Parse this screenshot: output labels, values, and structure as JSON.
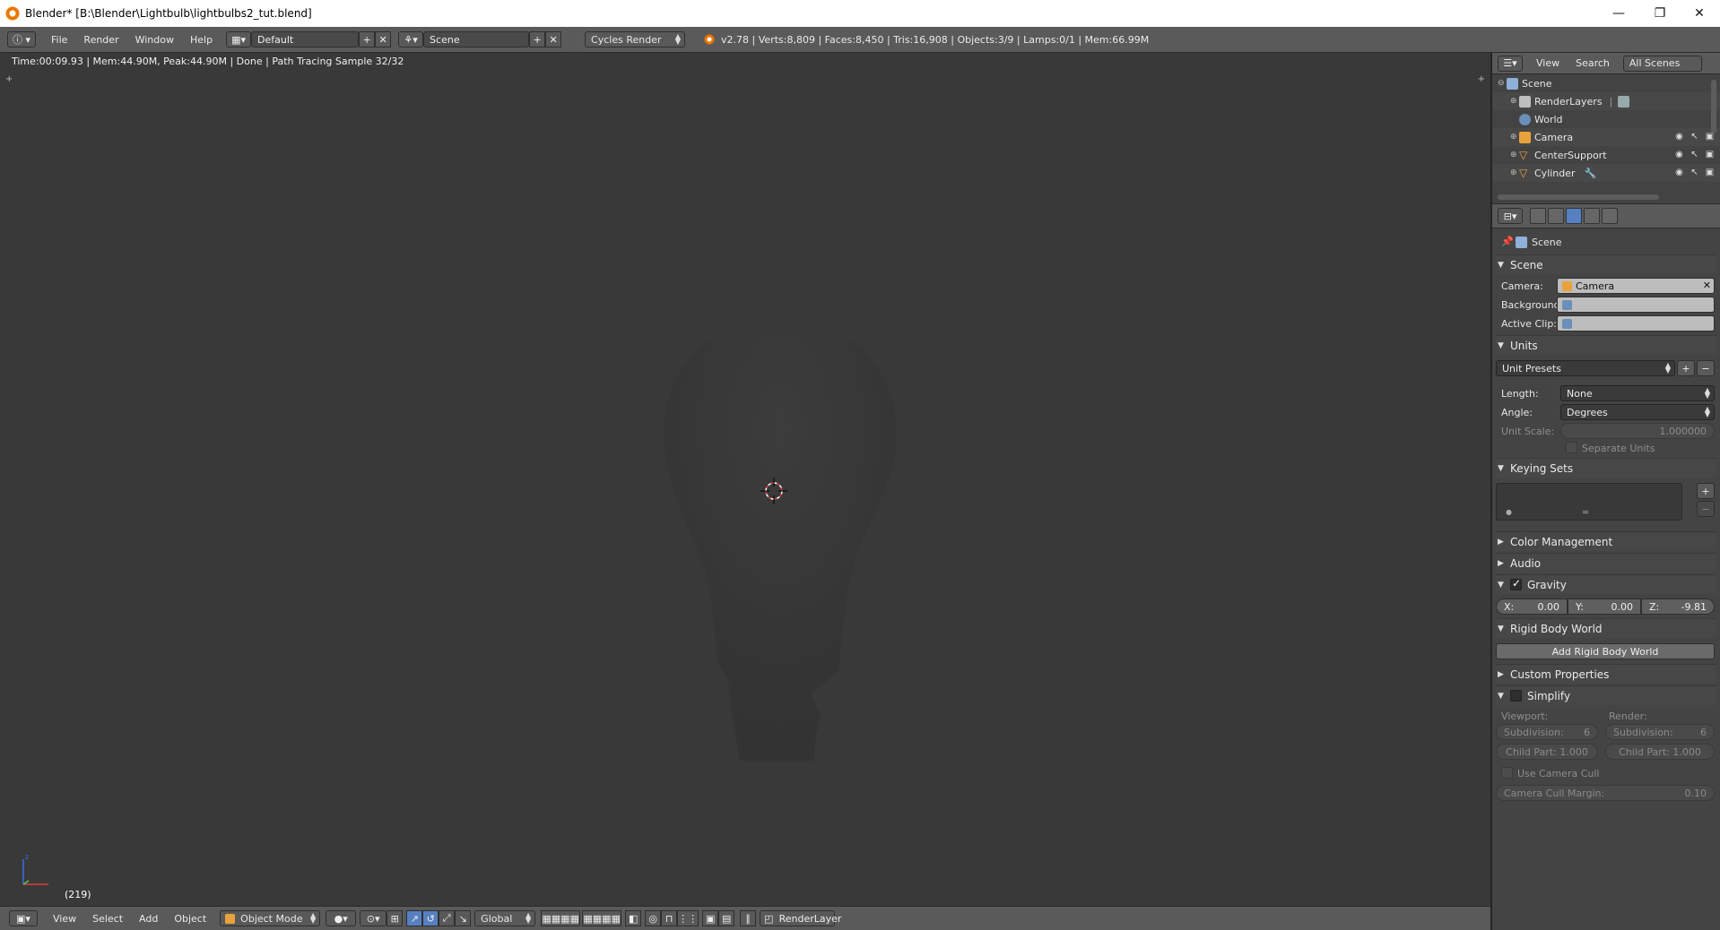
{
  "window": {
    "title": "Blender* [B:\\Blender\\Lightbulb\\lightbulbs2_tut.blend]",
    "minimize": "—",
    "maximize": "❐",
    "close": "✕"
  },
  "topbar": {
    "editor_icon": "info-editor-icon",
    "menus": [
      "File",
      "Render",
      "Window",
      "Help"
    ],
    "screen_layout": "Default",
    "scene": "Scene",
    "render_engine": "Cycles Render",
    "stats": "v2.78 | Verts:8,809 | Faces:8,450 | Tris:16,908 | Objects:3/9 | Lamps:0/1 | Mem:66.99M"
  },
  "viewport": {
    "render_info": "Time:00:09.93 | Mem:44.90M, Peak:44.90M | Done | Path Tracing Sample 32/32",
    "frame_label": "(219)",
    "background_color": "#393939",
    "bulb_color": "#333333"
  },
  "view_header": {
    "menus": [
      "View",
      "Select",
      "Add",
      "Object"
    ],
    "mode": "Object Mode",
    "orientation": "Global",
    "render_layer": "RenderLayer"
  },
  "outliner": {
    "menus": [
      "View",
      "Search"
    ],
    "display_mode": "All Scenes",
    "rows": [
      {
        "label": "Scene",
        "icon": "scene-icon"
      },
      {
        "label": "RenderLayers",
        "icon": "render-layers-icon"
      },
      {
        "label": "World",
        "icon": "world-icon"
      },
      {
        "label": "Camera",
        "icon": "camera-icon"
      },
      {
        "label": "CenterSupport",
        "icon": "mesh-icon"
      },
      {
        "label": "Cylinder",
        "icon": "mesh-icon"
      }
    ]
  },
  "properties": {
    "context": "Scene",
    "panels": {
      "scene": {
        "title": "Scene",
        "camera_label": "Camera:",
        "camera_value": "Camera",
        "background_label": "Background:",
        "active_clip_label": "Active Clip:"
      },
      "units": {
        "title": "Units",
        "presets": "Unit Presets",
        "length_label": "Length:",
        "length_value": "None",
        "angle_label": "Angle:",
        "angle_value": "Degrees",
        "unit_scale_label": "Unit Scale:",
        "unit_scale_value": "1.000000",
        "separate_units": "Separate Units"
      },
      "keying_sets": {
        "title": "Keying Sets"
      },
      "color_management": {
        "title": "Color Management"
      },
      "audio": {
        "title": "Audio"
      },
      "gravity": {
        "title": "Gravity",
        "x_label": "X:",
        "x_value": "0.00",
        "y_label": "Y:",
        "y_value": "0.00",
        "z_label": "Z:",
        "z_value": "-9.81"
      },
      "rigid_body_world": {
        "title": "Rigid Body World",
        "add_button": "Add Rigid Body World"
      },
      "custom_properties": {
        "title": "Custom Properties"
      },
      "simplify": {
        "title": "Simplify",
        "viewport_label": "Viewport:",
        "render_label": "Render:",
        "subdivision_label": "Subdivision:",
        "vp_subdivision": "6",
        "r_subdivision": "6",
        "child_part_vp": "Child Part: 1.000",
        "child_part_r": "Child Part: 1.000",
        "use_camera_cull": "Use Camera Cull",
        "camera_cull_margin_label": "Camera Cull Margin:",
        "camera_cull_margin_value": "0.10"
      }
    }
  }
}
